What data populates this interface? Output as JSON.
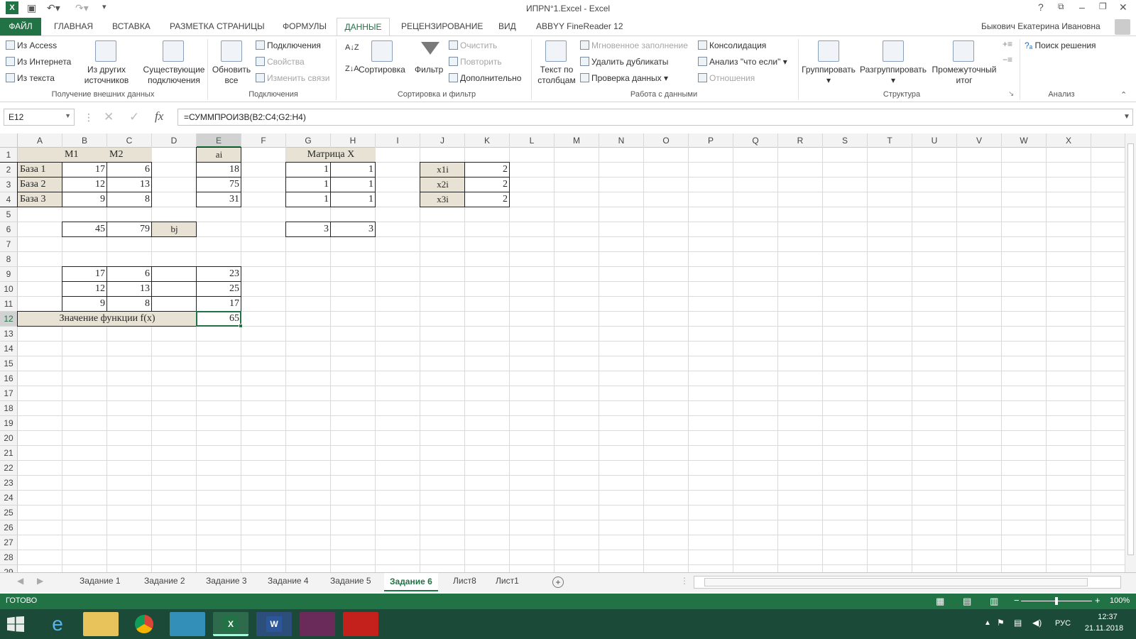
{
  "title": "ИПРN°1.Excel - Excel",
  "ribbon_tabs": [
    "ГЛАВНАЯ",
    "ВСТАВКА",
    "РАЗМЕТКА СТРАНИЦЫ",
    "ФОРМУЛЫ",
    "ДАННЫЕ",
    "РЕЦЕНЗИРОВАНИЕ",
    "ВИД",
    "ABBYY FineReader 12"
  ],
  "file_tab": "ФАЙЛ",
  "user": "Быкович Екатерина Ивановна",
  "ribbon": {
    "ext": {
      "access": "Из Access",
      "web": "Из Интернета",
      "text": "Из текста",
      "other": "Из других источников",
      "existing": "Существующие подключения",
      "group": "Получение внешних данных"
    },
    "conn": {
      "refresh": "Обновить все",
      "connections": "Подключения",
      "properties": "Свойства",
      "edit_links": "Изменить связи",
      "group": "Подключения"
    },
    "sort": {
      "sort": "Сортировка",
      "filter": "Фильтр",
      "clear": "Очистить",
      "reapply": "Повторить",
      "advanced": "Дополнительно",
      "group": "Сортировка и фильтр"
    },
    "tools": {
      "text_to_columns": "Текст по столбцам",
      "flash_fill": "Мгновенное заполнение",
      "remove_dup": "Удалить дубликаты",
      "validation": "Проверка данных",
      "consolidate": "Консолидация",
      "whatif": "Анализ \"что если\"",
      "relations": "Отношения",
      "group": "Работа с данными"
    },
    "outline": {
      "group_btn": "Группировать",
      "ungroup": "Разгруппировать",
      "subtotal": "Промежуточный итог",
      "group": "Структура"
    },
    "analysis": {
      "solver": "Поиск решения",
      "group": "Анализ"
    }
  },
  "name_box": "E12",
  "formula": "=СУММПРОИЗВ(B2:C4;G2:H4)",
  "columns": [
    "A",
    "B",
    "C",
    "D",
    "E",
    "F",
    "G",
    "H",
    "I",
    "J",
    "K",
    "L",
    "M",
    "N",
    "O",
    "P",
    "Q",
    "R",
    "S",
    "T",
    "U",
    "V",
    "W",
    "X"
  ],
  "rows": [
    "1",
    "2",
    "3",
    "4",
    "5",
    "6",
    "7",
    "8",
    "9",
    "10",
    "11",
    "12",
    "13",
    "14",
    "15",
    "16",
    "17",
    "18",
    "19",
    "20",
    "21",
    "22",
    "23",
    "24",
    "25",
    "26",
    "27",
    "28",
    "29"
  ],
  "cells": {
    "B1": "M1",
    "C1": "M2",
    "E1": "ai",
    "G1": "Матрица X",
    "A2": "База 1",
    "B2": "17",
    "C2": "6",
    "E2": "18",
    "G2": "1",
    "H2": "1",
    "J2": "x1i",
    "K2": "2",
    "A3": "База 2",
    "B3": "12",
    "C3": "13",
    "E3": "75",
    "G3": "1",
    "H3": "1",
    "J3": "x2i",
    "K3": "2",
    "A4": "База 3",
    "B4": "9",
    "C4": "8",
    "E4": "31",
    "G4": "1",
    "H4": "1",
    "J4": "x3i",
    "K4": "2",
    "B6": "45",
    "C6": "79",
    "D6": "bj",
    "G6": "3",
    "H6": "3",
    "B9": "17",
    "C9": "6",
    "E9": "23",
    "B10": "12",
    "C10": "13",
    "E10": "25",
    "B11": "9",
    "C11": "8",
    "E11": "17",
    "A12": "Значение функции f(x)",
    "E12": "65"
  },
  "sheet_tabs": [
    "Задание 1",
    "Задание 2",
    "Задание 3",
    "Задание 4",
    "Задание 5",
    "Задание 6",
    "Лист8",
    "Лист1"
  ],
  "active_sheet": "Задание 6",
  "status": {
    "ready": "ГОТОВО",
    "zoom": "100%"
  },
  "taskbar": {
    "lang": "РУС",
    "time": "12:37",
    "date": "21.11.2018"
  },
  "colors": {
    "excel_green": "#217346",
    "header_fill": "#e7e2d3"
  }
}
